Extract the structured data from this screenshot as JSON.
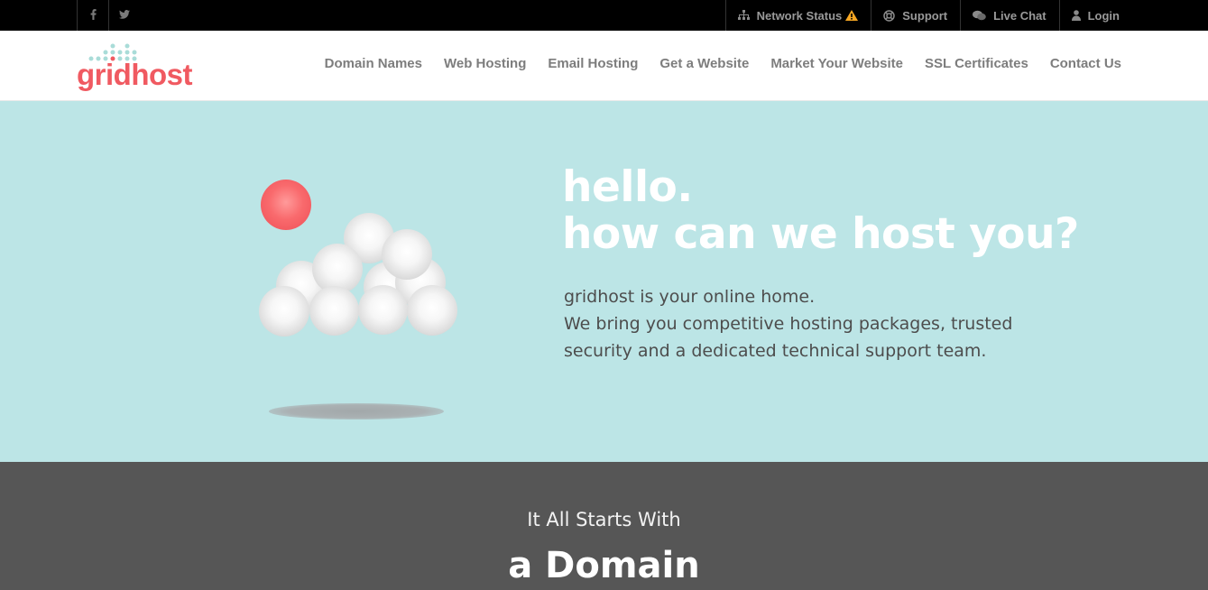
{
  "topbar": {
    "social": [
      {
        "icon": "facebook-icon",
        "glyph": "f"
      },
      {
        "icon": "twitter-icon",
        "glyph": "t"
      }
    ],
    "links": [
      {
        "label": "Network Status",
        "icon": "network-icon",
        "badge_icon": "warning-icon"
      },
      {
        "label": "Support",
        "icon": "lifebuoy-icon"
      },
      {
        "label": "Live Chat",
        "icon": "chat-icon"
      },
      {
        "label": "Login",
        "icon": "user-icon"
      }
    ]
  },
  "header": {
    "logo_text": "gridhost",
    "nav": [
      "Domain Names",
      "Web Hosting",
      "Email Hosting",
      "Get a Website",
      "Market Your Website",
      "SSL Certificates",
      "Contact Us"
    ]
  },
  "hero": {
    "headline_line1": "hello.",
    "headline_line2": "how can we host you?",
    "intro_line1": "gridhost is your online home.",
    "intro_line2": "We bring you competitive hosting packages, trusted",
    "intro_line3": "security and a dedicated technical support team."
  },
  "domain_section": {
    "subtitle": "It All Starts With",
    "title": "a Domain"
  },
  "colors": {
    "brand": "#f05a61",
    "logo_dots": "#a9dcd8",
    "hero_bg": "#bce5e6",
    "topbar_bg": "#000000",
    "domain_bg": "#565656",
    "warning": "#f5a623"
  }
}
